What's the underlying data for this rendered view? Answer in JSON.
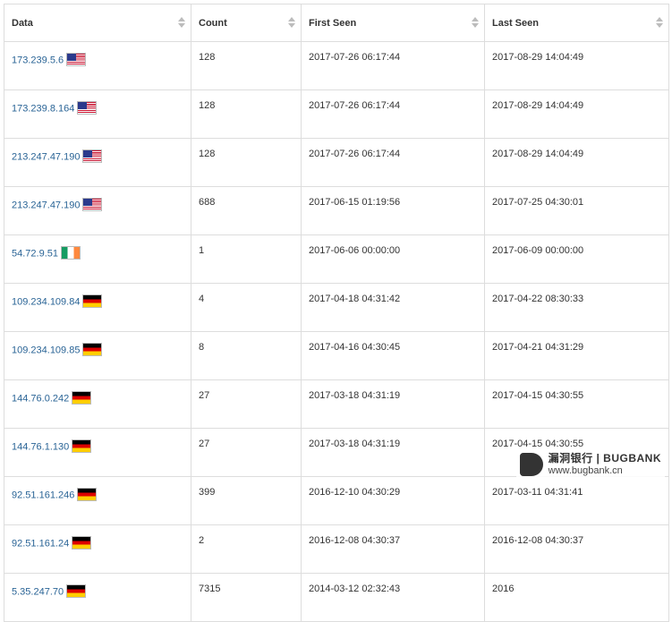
{
  "table": {
    "columns": [
      {
        "label": "Data"
      },
      {
        "label": "Count"
      },
      {
        "label": "First Seen"
      },
      {
        "label": "Last Seen"
      }
    ],
    "rows": [
      {
        "ip": "173.239.5.6",
        "flag": "us-flag-icon",
        "count": "128",
        "first_seen": "2017-07-26 06:17:44",
        "last_seen": "2017-08-29 14:04:49"
      },
      {
        "ip": "173.239.8.164",
        "flag": "us-flag-icon",
        "count": "128",
        "first_seen": "2017-07-26 06:17:44",
        "last_seen": "2017-08-29 14:04:49"
      },
      {
        "ip": "213.247.47.190",
        "flag": "us-flag-icon",
        "count": "128",
        "first_seen": "2017-07-26 06:17:44",
        "last_seen": "2017-08-29 14:04:49"
      },
      {
        "ip": "213.247.47.190",
        "flag": "us-flag-icon",
        "count": "688",
        "first_seen": "2017-06-15 01:19:56",
        "last_seen": "2017-07-25 04:30:01"
      },
      {
        "ip": "54.72.9.51",
        "flag": "ie-flag-icon",
        "count": "1",
        "first_seen": "2017-06-06 00:00:00",
        "last_seen": "2017-06-09 00:00:00"
      },
      {
        "ip": "109.234.109.84",
        "flag": "de-flag-icon",
        "count": "4",
        "first_seen": "2017-04-18 04:31:42",
        "last_seen": "2017-04-22 08:30:33"
      },
      {
        "ip": "109.234.109.85",
        "flag": "de-flag-icon",
        "count": "8",
        "first_seen": "2017-04-16 04:30:45",
        "last_seen": "2017-04-21 04:31:29"
      },
      {
        "ip": "144.76.0.242",
        "flag": "de-flag-icon",
        "count": "27",
        "first_seen": "2017-03-18 04:31:19",
        "last_seen": "2017-04-15 04:30:55"
      },
      {
        "ip": "144.76.1.130",
        "flag": "de-flag-icon",
        "count": "27",
        "first_seen": "2017-03-18 04:31:19",
        "last_seen": "2017-04-15 04:30:55"
      },
      {
        "ip": "92.51.161.246",
        "flag": "de-flag-icon",
        "count": "399",
        "first_seen": "2016-12-10 04:30:29",
        "last_seen": "2017-03-11 04:31:41"
      },
      {
        "ip": "92.51.161.24",
        "flag": "de-flag-icon",
        "count": "2",
        "first_seen": "2016-12-08 04:30:37",
        "last_seen": "2016-12-08 04:30:37"
      },
      {
        "ip": "5.35.247.70",
        "flag": "de-flag-icon",
        "count": "7315",
        "first_seen": "2014-03-12 02:32:43",
        "last_seen": "2016"
      }
    ]
  },
  "watermark": {
    "name": "漏洞银行 | BUGBANK",
    "url": "www.bugbank.cn"
  }
}
